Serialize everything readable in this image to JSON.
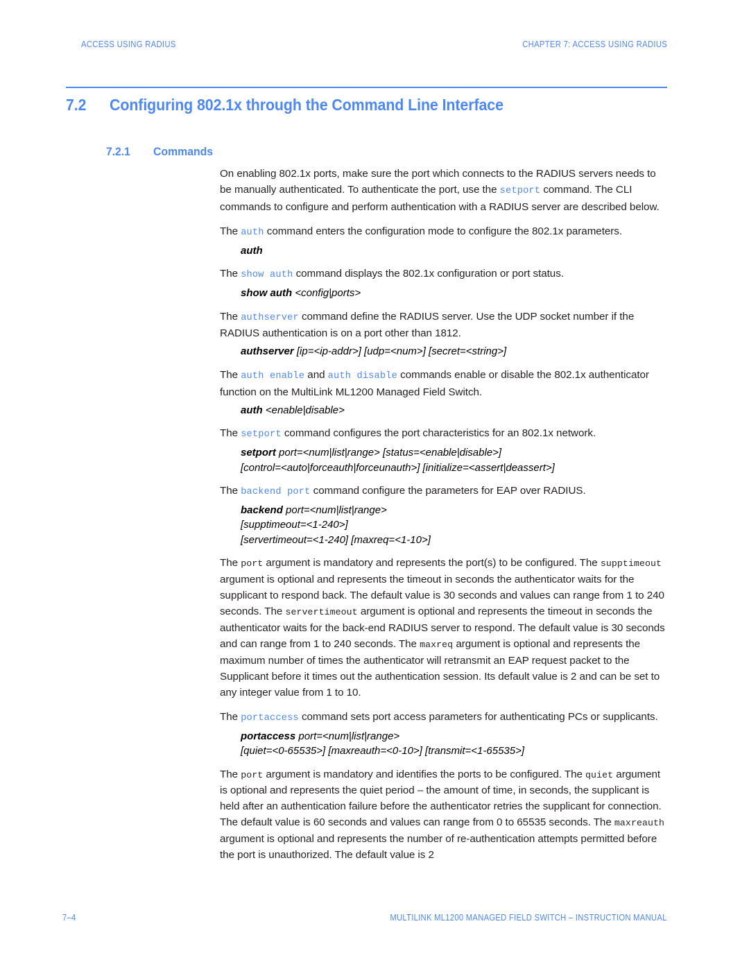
{
  "header": {
    "left": "ACCESS USING RADIUS",
    "right": "CHAPTER 7: ACCESS USING RADIUS"
  },
  "headings": {
    "h1_number": "7.2",
    "h1_title": "Configuring 802.1x through the Command Line Interface",
    "h2_number": "7.2.1",
    "h2_title": "Commands"
  },
  "paragraphs": {
    "intro_a": "On enabling 802.1x ports, make sure the port which connects to the RADIUS servers needs to be manually authenticated. To authenticate the port, use the ",
    "intro_code": "setport",
    "intro_b": " command. The CLI commands to configure and perform authentication with a RADIUS server are described below.",
    "auth_a": "The ",
    "auth_code": "auth",
    "auth_b": " command enters the configuration mode to configure the 802.1x parameters.",
    "showauth_a": "The ",
    "showauth_code": "show auth",
    "showauth_b": " command displays the 802.1x configuration or port status.",
    "authserver_a": "The ",
    "authserver_code": "authserver",
    "authserver_b": " command define the RADIUS server. Use the UDP socket number if the RADIUS authentication is on a port other than 1812.",
    "authen_a": "The ",
    "authen_code1": "auth enable",
    "authen_b": " and ",
    "authen_code2": "auth disable",
    "authen_c": " commands enable or disable the 802.1x authenticator function on the MultiLink ML1200 Managed Field Switch.",
    "setport_a": "The ",
    "setport_code": "setport",
    "setport_b": " command configures the port characteristics for an 802.1x network.",
    "backend_a": "The ",
    "backend_code": "backend port",
    "backend_b": " command configure the parameters for EAP over RADIUS.",
    "args1_a": "The ",
    "args1_c1": "port",
    "args1_b": " argument is mandatory and represents the port(s) to be configured. The ",
    "args1_c2": "supptimeout",
    "args1_c": " argument is optional and represents the timeout in seconds the authenticator waits for the supplicant to respond back. The default value is 30 seconds and values can range from 1 to 240 seconds. The ",
    "args1_c3": "servertimeout",
    "args1_d": " argument is optional and represents the timeout in seconds the authenticator waits for the back-end RADIUS server to respond. The default value is 30 seconds and can range from 1 to 240 seconds. The ",
    "args1_c4": "maxreq",
    "args1_e": " argument is optional and represents the maximum number of times the authenticator will retransmit an EAP request packet to the Supplicant before it times out the authentication session. Its default value is 2 and can be set to any integer value from 1 to 10.",
    "portaccess_a": "The ",
    "portaccess_code": "portaccess",
    "portaccess_b": " command sets port access parameters for authenticating PCs or supplicants.",
    "args2_a": "The ",
    "args2_c1": "port",
    "args2_b": " argument is mandatory and identifies the ports to be configured. The ",
    "args2_c2": "quiet",
    "args2_c": " argument is optional and represents the quiet period – the amount of time, in seconds, the supplicant is held after an authentication failure before the authenticator retries the supplicant for connection. The default value is 60 seconds and values can range from 0 to 65535 seconds. The ",
    "args2_c3": "maxreauth",
    "args2_d": " argument is optional and represents the number of re-authentication attempts permitted before the port is unauthorized. The default value is 2"
  },
  "command_syntax": {
    "auth": {
      "name": "auth",
      "args": ""
    },
    "show_auth": {
      "name": "show auth",
      "args": " <config|ports>"
    },
    "authserver": {
      "name": "authserver",
      "args": " [ip=<ip-addr>] [udp=<num>] [secret=<string>]"
    },
    "auth_enable": {
      "name": "auth",
      "args": " <enable|disable>"
    },
    "setport": {
      "name": "setport",
      "args": " port=<num|list|range> [status=<enable|disable>]",
      "line2": "[control=<auto|forceauth|forceunauth>] [initialize=<assert|deassert>]"
    },
    "backend": {
      "name": "backend",
      "args": " port=<num|list|range>",
      "line2": "[supptimeout=<1-240>]",
      "line3": "[servertimeout=<1-240] [maxreq=<1-10>]"
    },
    "portaccess": {
      "name": "portaccess",
      "args": " port=<num|list|range>",
      "line2": "[quiet=<0-65535>] [maxreauth=<0-10>] [transmit=<1-65535>]"
    }
  },
  "footer": {
    "page_number": "7–4",
    "manual_title": "MULTILINK ML1200 MANAGED FIELD SWITCH – INSTRUCTION MANUAL"
  },
  "colors": {
    "accent_blue": "#4d88f0",
    "body_text": "#231f20"
  }
}
